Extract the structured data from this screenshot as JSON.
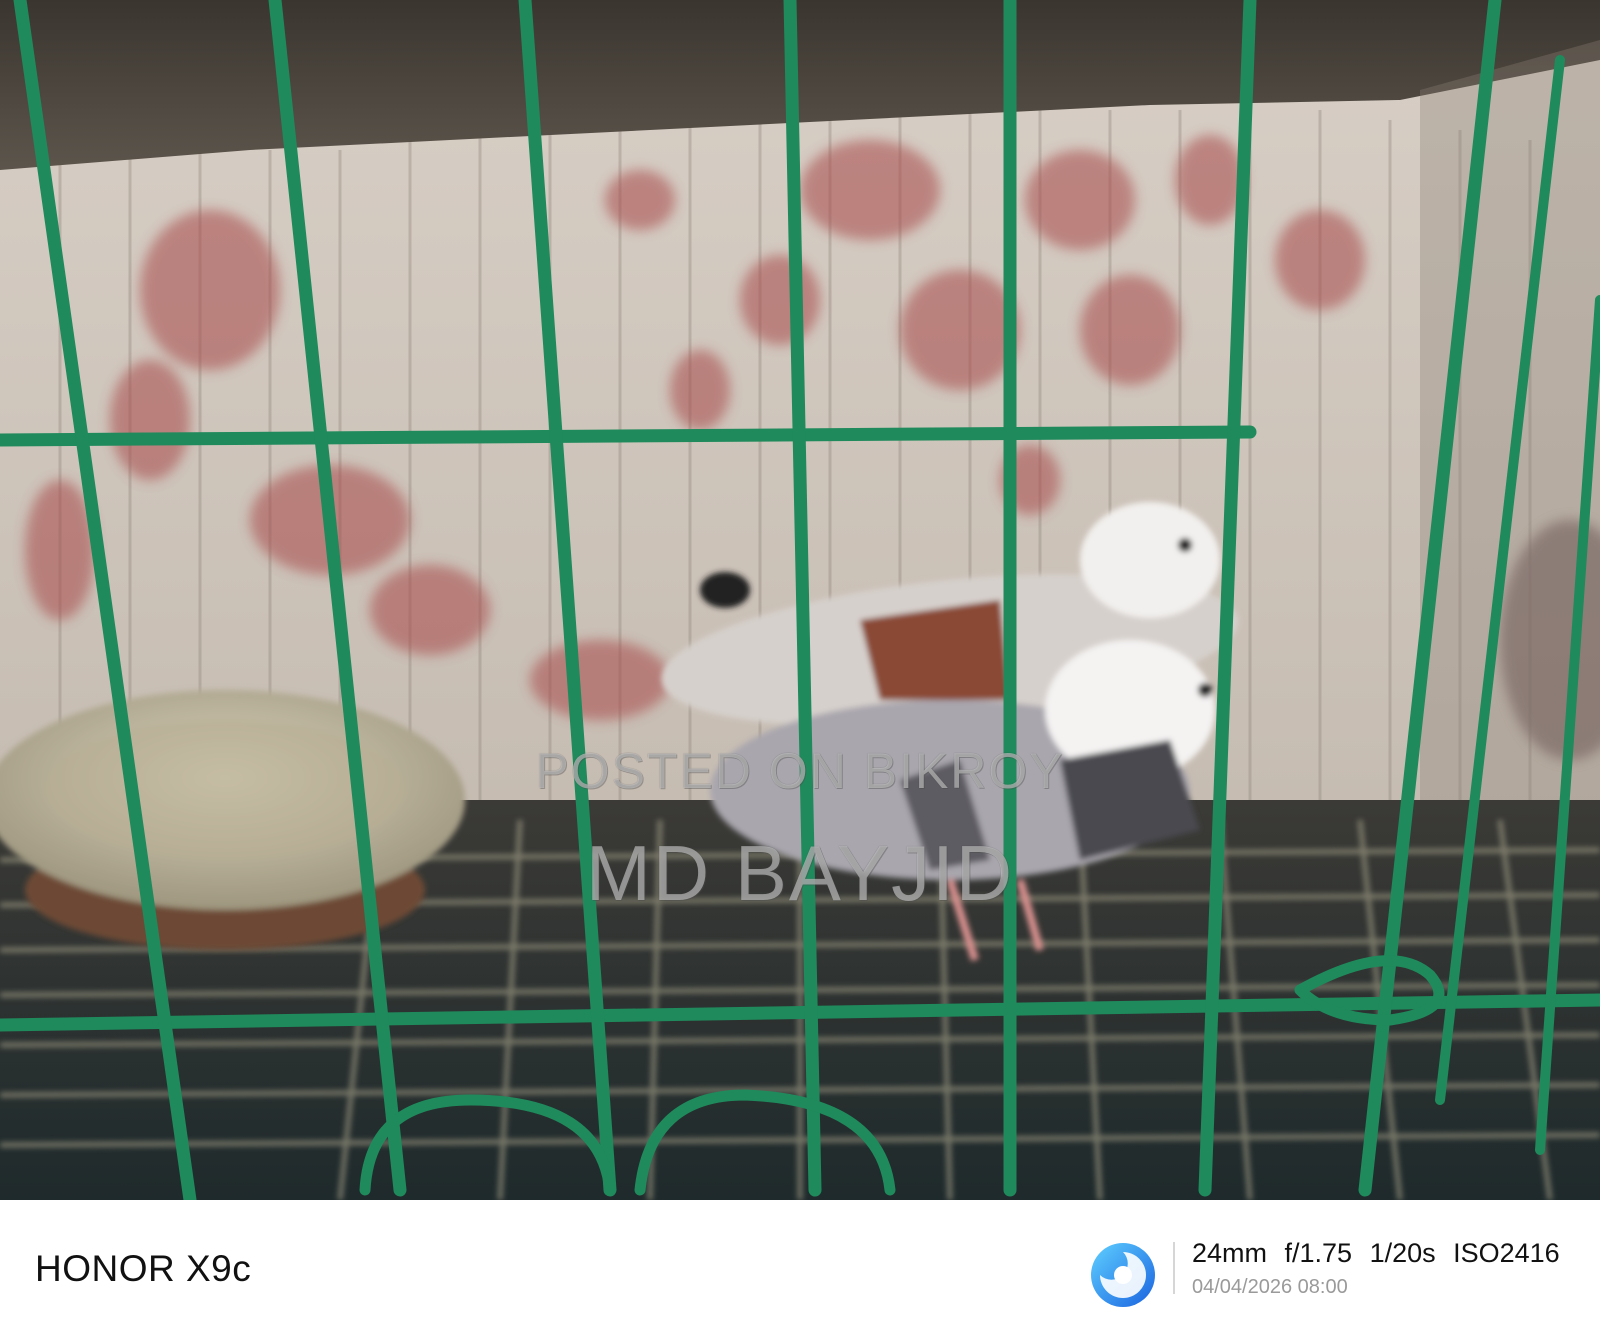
{
  "watermark": {
    "line1": "POSTED ON BIKROY",
    "line2": "MD BAYJID"
  },
  "footer": {
    "brand": "HONOR X9c",
    "specs": "24mm f/1.75 1/20s ISO2416",
    "datetime": "04/04/2026 08:00",
    "logo_icon": "camera-lens-logo-icon"
  },
  "colors": {
    "cage_wire": "#1f8a5c",
    "wall_pattern": "#a84a4a",
    "footer_bg": "#ffffff"
  }
}
